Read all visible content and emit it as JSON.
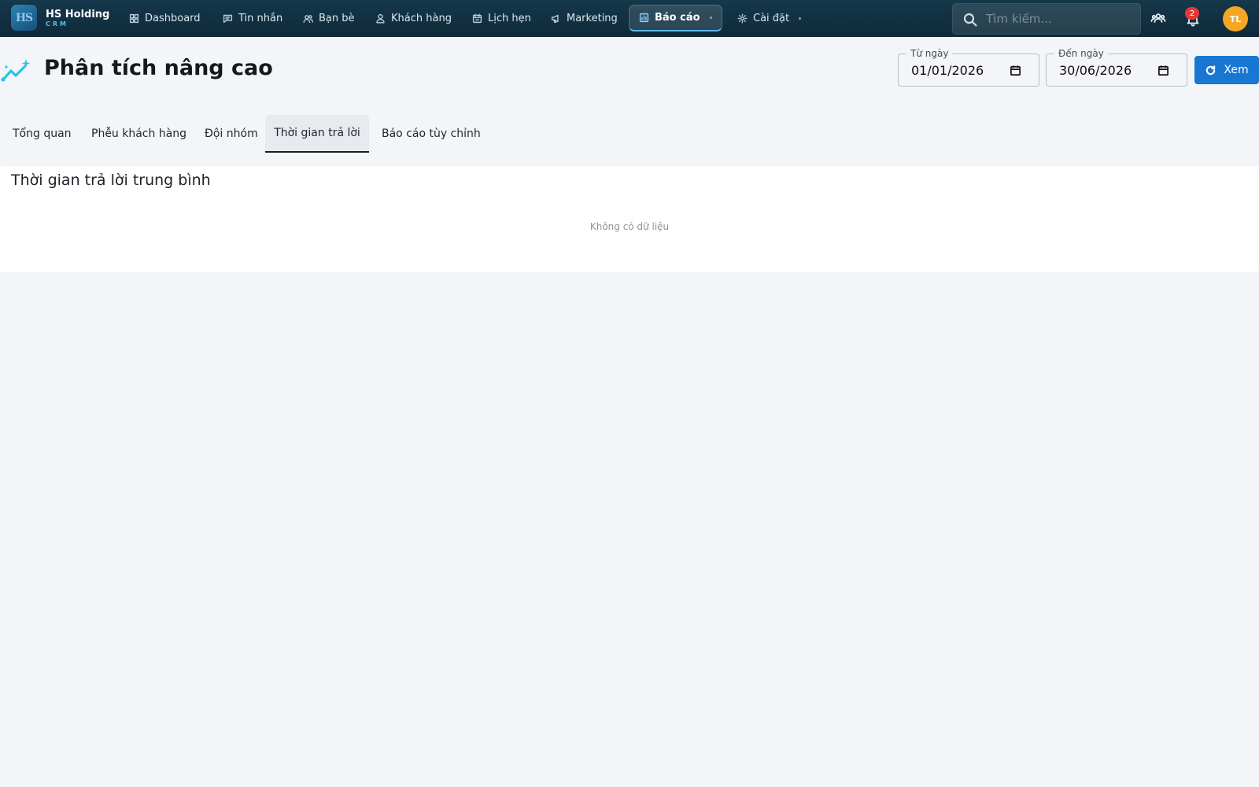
{
  "brand": {
    "logo_text": "HS",
    "name": "HS Holding",
    "sub": "CRM"
  },
  "nav": {
    "items": [
      {
        "label": "Dashboard",
        "icon": "dashboard-icon"
      },
      {
        "label": "Tin nhắn",
        "icon": "message-icon"
      },
      {
        "label": "Bạn bè",
        "icon": "friends-icon"
      },
      {
        "label": "Khách hàng",
        "icon": "person-icon"
      },
      {
        "label": "Lịch hẹn",
        "icon": "calendar-icon"
      },
      {
        "label": "Marketing",
        "icon": "megaphone-icon"
      },
      {
        "label": "Báo cáo",
        "icon": "report-icon",
        "active": true
      },
      {
        "label": "Cài đặt",
        "icon": "gear-icon"
      }
    ]
  },
  "search": {
    "placeholder": "Tìm kiếm..."
  },
  "notifications": {
    "count": "2"
  },
  "user": {
    "initials": "TL"
  },
  "page": {
    "title": "Phân tích nâng cao"
  },
  "filters": {
    "from_label": "Từ ngày",
    "from_value": "01/01/2026",
    "to_label": "Đến ngày",
    "to_value": "30/06/2026",
    "view_label": "Xem"
  },
  "tabs": [
    {
      "label": "Tổng quan"
    },
    {
      "label": "Phễu khách hàng"
    },
    {
      "label": "Đội nhóm"
    },
    {
      "label": "Thời gian trả lời",
      "active": true
    },
    {
      "label": "Báo cáo tùy chỉnh"
    }
  ],
  "card": {
    "title": "Thời gian trả lời trung bình",
    "empty_text": "Không có dữ liệu"
  },
  "colors": {
    "topbar": "#0f2a3a",
    "accent": "#1976d2",
    "avatar": "#f5a623",
    "badge": "#e53935",
    "title_icon": "#29c4e8"
  }
}
